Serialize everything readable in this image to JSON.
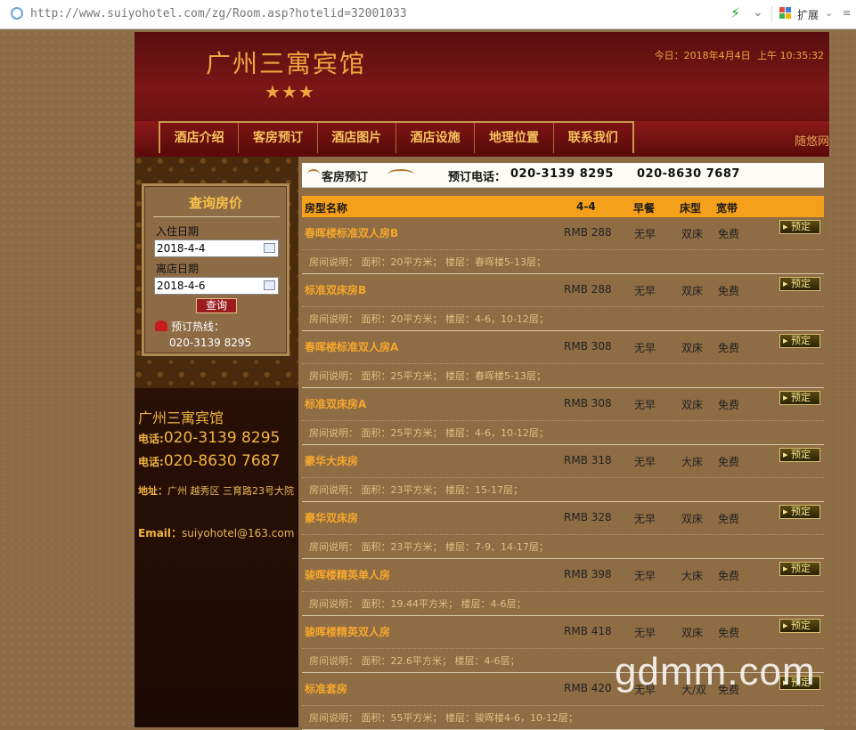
{
  "browser": {
    "url": "http://www.suiyohotel.com/zg/Room.asp?hotelid=32001033",
    "extensions_label": "扩展"
  },
  "header": {
    "hotel_name": "广州三寓宾馆",
    "stars": "★★★",
    "date_label": "今日：2018年4月4日",
    "time_label": "上午 10:35:32",
    "brand_right": "随悠网"
  },
  "nav": {
    "items": [
      "酒店介绍",
      "客房预订",
      "酒店图片",
      "酒店设施",
      "地理位置",
      "联系我们"
    ]
  },
  "query": {
    "title": "查询房价",
    "checkin_label": "入住日期",
    "checkin_value": "2018-4-4",
    "checkout_label": "离店日期",
    "checkout_value": "2018-4-6",
    "button_label": "查询",
    "hotline_label": "预订热线：",
    "hotline_number": "020-3139 8295"
  },
  "contact": {
    "name": "广州三寓宾馆",
    "tel_label": "电话:",
    "tel1": "020-3139 8295",
    "tel2": "020-8630 7687",
    "address_label": "地址：",
    "address_value": "广州 越秀区 三育路23号大院",
    "email_label": "Email：",
    "email_value": "suiyohotel@163.com"
  },
  "booking": {
    "banner_label": "客房预订",
    "phone_label": "预订电话：",
    "phone1": "020-3139 8295",
    "phone2": "020-8630 7687"
  },
  "table": {
    "headers": {
      "name": "房型名称",
      "date": "4-4",
      "breakfast": "早餐",
      "bed": "床型",
      "broadband": "宽带"
    },
    "book_label": "预定",
    "rooms": [
      {
        "name": "春晖楼标准双人房B",
        "price": "RMB 288",
        "breakfast": "无早",
        "bed": "双床",
        "net": "免费",
        "desc": "房间说明： 面积：20平方米； 楼层：春晖楼5-13层；"
      },
      {
        "name": "标准双床房B",
        "price": "RMB 288",
        "breakfast": "无早",
        "bed": "双床",
        "net": "免费",
        "desc": "房间说明： 面积：20平方米； 楼层：4-6，10-12层；"
      },
      {
        "name": "春晖楼标准双人房A",
        "price": "RMB 308",
        "breakfast": "无早",
        "bed": "双床",
        "net": "免费",
        "desc": "房间说明： 面积：25平方米； 楼层：春晖楼5-13层；"
      },
      {
        "name": "标准双床房A",
        "price": "RMB 308",
        "breakfast": "无早",
        "bed": "双床",
        "net": "免费",
        "desc": "房间说明： 面积：25平方米； 楼层：4-6，10-12层；"
      },
      {
        "name": "豪华大床房",
        "price": "RMB 318",
        "breakfast": "无早",
        "bed": "大床",
        "net": "免费",
        "desc": "房间说明： 面积：23平方米； 楼层：15-17层；"
      },
      {
        "name": "豪华双床房",
        "price": "RMB 328",
        "breakfast": "无早",
        "bed": "双床",
        "net": "免费",
        "desc": "房间说明： 面积：23平方米； 楼层：7-9、14-17层；"
      },
      {
        "name": "骏晖楼精英单人房",
        "price": "RMB 398",
        "breakfast": "无早",
        "bed": "大床",
        "net": "免费",
        "desc": "房间说明： 面积：19.44平方米； 楼层：4-6层；"
      },
      {
        "name": "骏晖楼精英双人房",
        "price": "RMB 418",
        "breakfast": "无早",
        "bed": "双床",
        "net": "免费",
        "desc": "房间说明： 面积：22.6平方米； 楼层：4-6层；"
      },
      {
        "name": "标准套房",
        "price": "RMB 420",
        "breakfast": "无早",
        "bed": "大/双",
        "net": "免费",
        "desc": "房间说明： 面积：55平方米； 楼层：骏晖楼4-6，10-12层；"
      }
    ]
  },
  "watermark": "gdmm.com"
}
